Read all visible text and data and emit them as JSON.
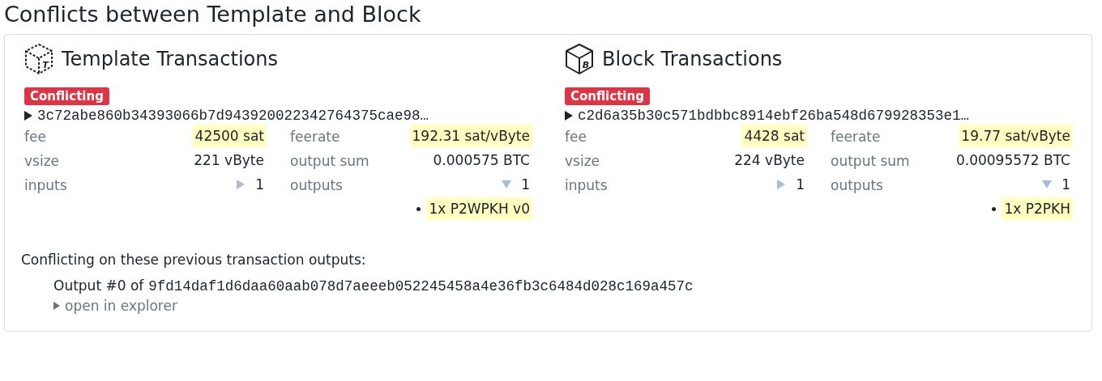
{
  "title": "Conflicts between Template and Block",
  "panels": [
    {
      "kind": "template",
      "icon_letter": "T",
      "heading": "Template Transactions",
      "badge": "Conflicting",
      "txid": "3c72abe860b34393066b7d943920022342764375cae98…",
      "expanded": false,
      "stats": [
        {
          "label": "fee",
          "value": "42500 sat",
          "highlight": true
        },
        {
          "label": "feerate",
          "value": "192.31 sat/vByte",
          "highlight": true
        },
        {
          "label": "vsize",
          "value": "221 vByte",
          "highlight": false
        },
        {
          "label": "output sum",
          "value": "0.000575 BTC",
          "highlight": false
        },
        {
          "label": "inputs",
          "value": "1",
          "highlight": false,
          "expanded": false
        },
        {
          "label": "outputs",
          "value": "1",
          "highlight": false,
          "expanded": true,
          "items": [
            {
              "text": "1x P2WPKH v0",
              "highlight": true
            }
          ]
        }
      ]
    },
    {
      "kind": "block",
      "icon_letter": "B",
      "heading": "Block Transactions",
      "badge": "Conflicting",
      "txid": "c2d6a35b30c571bdbbc8914ebf26ba548d679928353e1…",
      "expanded": false,
      "stats": [
        {
          "label": "fee",
          "value": "4428 sat",
          "highlight": true
        },
        {
          "label": "feerate",
          "value": "19.77 sat/vByte",
          "highlight": true
        },
        {
          "label": "vsize",
          "value": "224 vByte",
          "highlight": false
        },
        {
          "label": "output sum",
          "value": "0.00095572 BTC",
          "highlight": false
        },
        {
          "label": "inputs",
          "value": "1",
          "highlight": false,
          "expanded": false
        },
        {
          "label": "outputs",
          "value": "1",
          "highlight": false,
          "expanded": true,
          "items": [
            {
              "text": "1x P2PKH",
              "highlight": true
            }
          ]
        }
      ]
    }
  ],
  "conflicts": {
    "heading": "Conflicting on these previous transaction outputs:",
    "items": [
      {
        "prefix": "Output #0 of",
        "txid": "9fd14daf1d6daa60aab078d7aeeeb052245458a4e36fb3c6484d028c169a457c",
        "link": "open in explorer",
        "expanded": false
      }
    ]
  }
}
